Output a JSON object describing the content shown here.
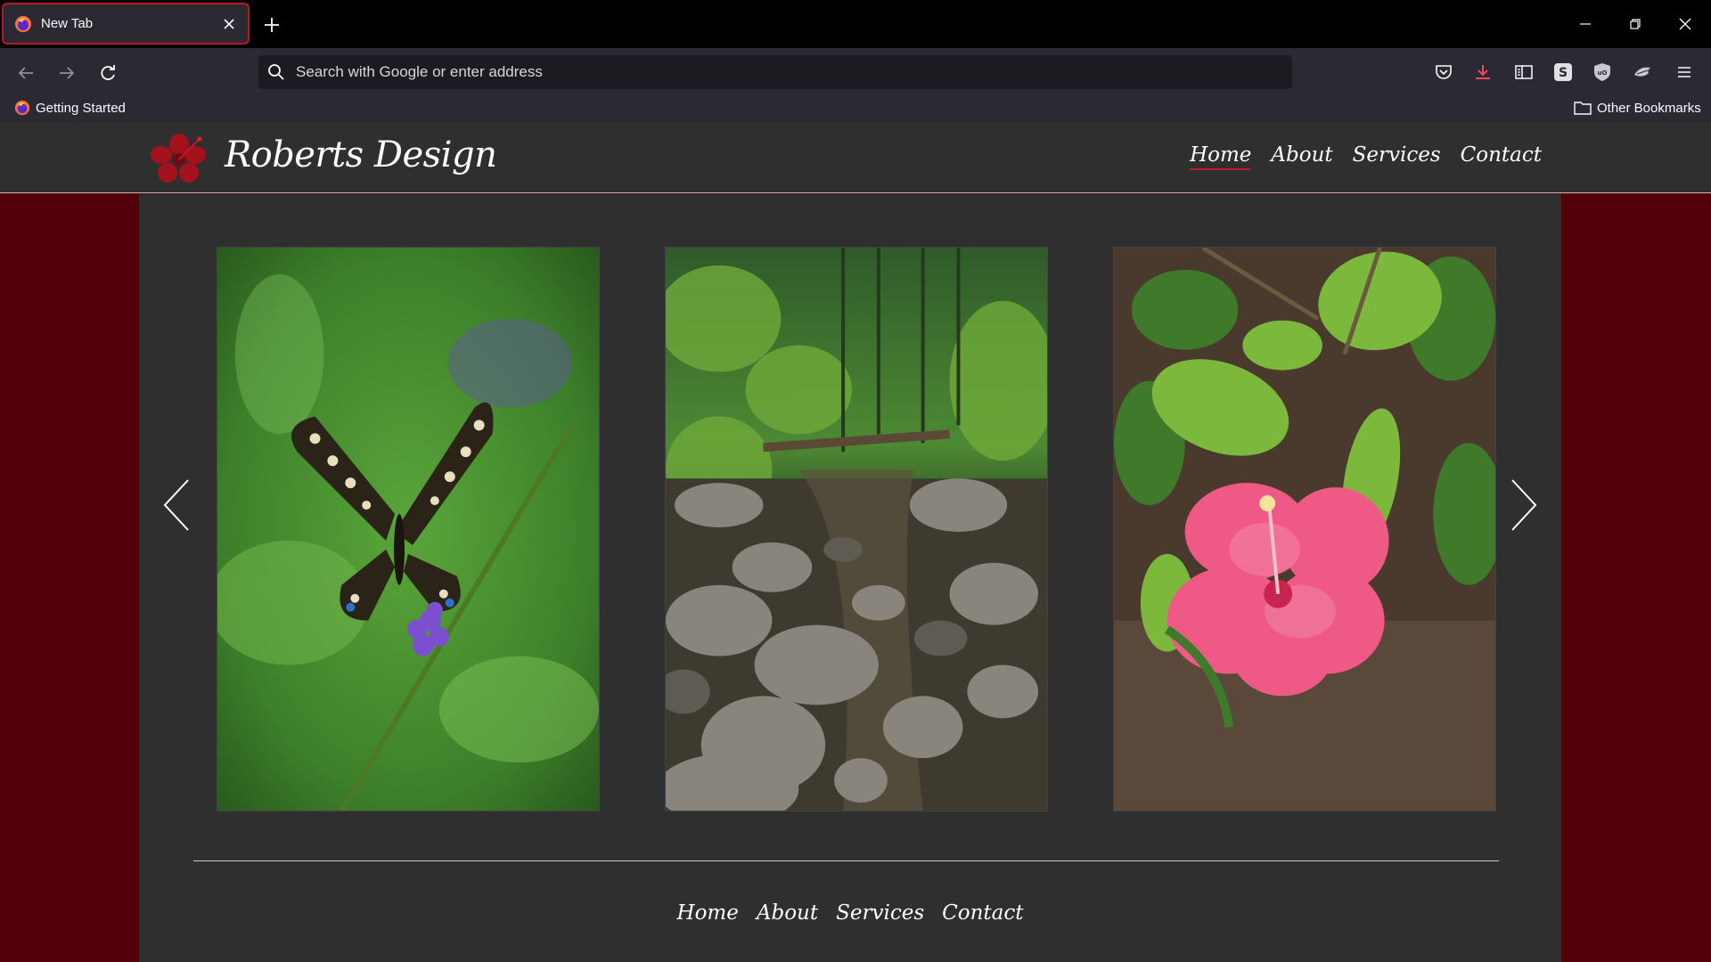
{
  "browser": {
    "tab": {
      "title": "New Tab"
    },
    "urlbar": {
      "placeholder": "Search with Google or enter address"
    },
    "bookmarks": {
      "left": "Getting Started",
      "right": "Other Bookmarks"
    }
  },
  "site": {
    "title": "Roberts Design",
    "nav": [
      "Home",
      "About",
      "Services",
      "Contact"
    ],
    "active_nav": "Home",
    "footer_nav": [
      "Home",
      "About",
      "Services",
      "Contact"
    ],
    "colors": {
      "accent": "#c11a24",
      "background": "#540009",
      "panel": "#2f2f2f"
    },
    "gallery": [
      {
        "subject": "butterfly-on-purple-flower"
      },
      {
        "subject": "rocky-forest-stream"
      },
      {
        "subject": "pink-hibiscus-flower"
      }
    ]
  }
}
